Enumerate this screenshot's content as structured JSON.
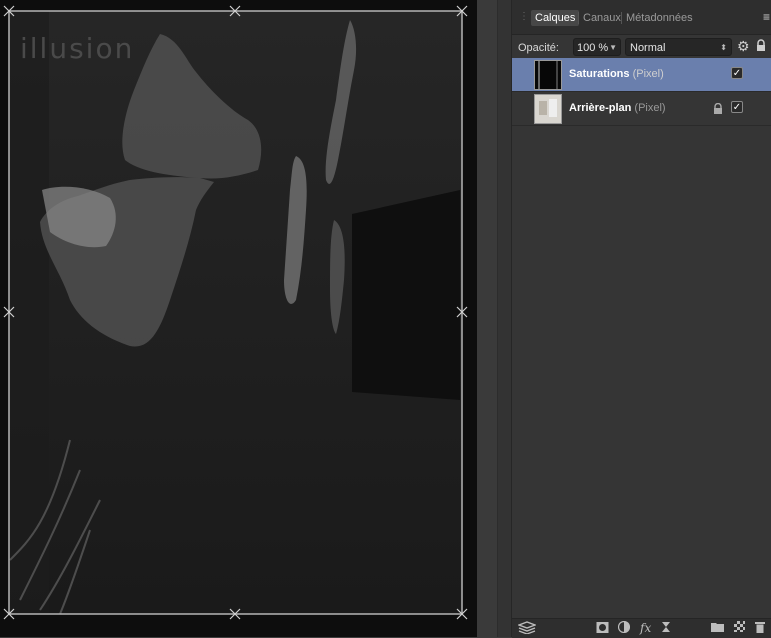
{
  "canvas": {
    "watermark": "illusion"
  },
  "panel": {
    "tabs": [
      {
        "label": "Calques",
        "active": true
      },
      {
        "label": "Canaux",
        "active": false
      },
      {
        "label": "Métadonnées",
        "active": false
      }
    ],
    "opacity_label": "Opacité:",
    "opacity_value": "100 %",
    "blend_mode": "Normal",
    "layers": [
      {
        "name": "Saturations",
        "type": "(Pixel)",
        "selected": true,
        "visible": true,
        "locked": false
      },
      {
        "name": "Arrière-plan",
        "type": "(Pixel)",
        "selected": false,
        "visible": true,
        "locked": true
      }
    ],
    "check_glyph": "✓"
  },
  "icons": {
    "panel_menu": "hamburger-icon",
    "settings": "gear-icon",
    "lock": "lock-icon",
    "bottom": [
      "layers-stack-icon",
      "mask-icon",
      "adjustment-icon",
      "fx-icon",
      "hourglass-icon",
      "folder-icon",
      "checker-icon",
      "trash-icon"
    ]
  },
  "colors": {
    "selected_layer": "#6a7fad",
    "panel_bg": "#353535",
    "canvas_bg": "#111111"
  }
}
